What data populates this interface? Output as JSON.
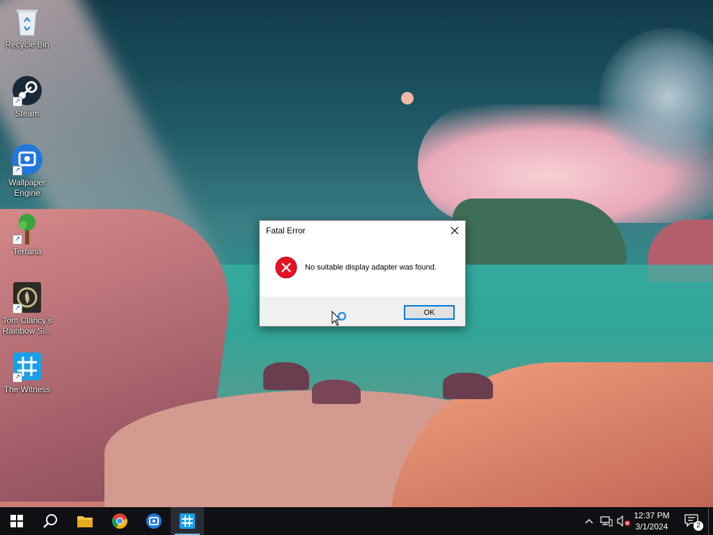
{
  "desktop": {
    "icons": [
      {
        "label": "Recycle Bin",
        "icon": "recycle-bin-icon"
      },
      {
        "label": "Steam",
        "icon": "steam-icon"
      },
      {
        "label": "Wallpaper Engine",
        "icon": "wallpaper-engine-icon"
      },
      {
        "label": "Terraria",
        "icon": "terraria-icon"
      },
      {
        "label": "Tom Clancy's Rainbow Si...",
        "icon": "rainbow-six-icon"
      },
      {
        "label": "The Witness",
        "icon": "the-witness-icon"
      }
    ]
  },
  "dialog": {
    "title": "Fatal Error",
    "message": "No suitable display adapter was found.",
    "ok_label": "OK",
    "icon": "error-icon"
  },
  "taskbar": {
    "items": [
      "start-icon",
      "search-icon",
      "file-explorer-icon",
      "chrome-icon",
      "wallpaper-engine-icon",
      "the-witness-icon"
    ],
    "active_item": "the-witness-icon",
    "clock": {
      "time": "12:37 PM",
      "date": "3/1/2024"
    },
    "notifications_count": "2"
  },
  "colors": {
    "accent": "#0078d7",
    "error_red": "#e81123",
    "taskbar": "#101014"
  }
}
